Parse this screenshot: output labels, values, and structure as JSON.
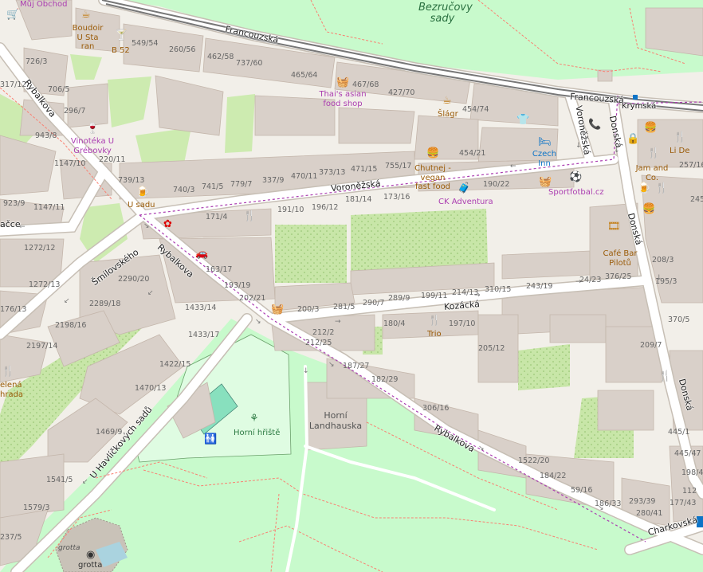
{
  "streets": {
    "francouzska_1": "Francouzská",
    "francouzska_2": "Francouzská",
    "krymska": "Krymská",
    "voronezska_1": "Voroněžská",
    "voronezska_2": "Voroněžská",
    "donska_1": "Donská",
    "donska_2": "Donská",
    "donska_3": "Donská",
    "rybalkova_1": "Rybalkova",
    "rybalkova_2": "Rybalkova",
    "rybalkova_3": "Rybalkova",
    "kozacka": "Kozácká",
    "smilovskeho": "Šmilovského",
    "u_havlickovych_sadu": "U Havlíčkových sadů",
    "charkovska": "Charkovská",
    "krymska_edge": "ačce"
  },
  "areas": {
    "bezrucovy_sady": "Bezručovy sady",
    "horni_landhauska": "Horní Landhauska",
    "horni_hriste": "Horní hřiště",
    "grotta_1": "grotta",
    "grotta_2": "grotta"
  },
  "pois": {
    "muj_obchod": "Můj Obchod",
    "boudoir": "Boudoir U Sta ran",
    "b52": "B 52",
    "thais_asian": "Thai's asian food shop",
    "slagr": "Šlágr",
    "vinoteka": "Vinotéka U Grébovky",
    "czech_inn": "Czech Inn",
    "chutnej": "Chutnej - vegan fast food",
    "ck_adventura": "CK Adventura",
    "sportfotbal": "Sportfotbal.cz",
    "u_sadu": "U sadu",
    "jam_and_co": "Jam and Co.",
    "li_de": "Li De",
    "cafe_bar_pilotu": "Café Bar Pilotů",
    "trio": "Trio",
    "zelena_zahrada": "elená hrada"
  },
  "housenumbers": [
    "549/54",
    "260/56",
    "462/58",
    "737/60",
    "465/64",
    "467/68",
    "427/70",
    "454/74",
    "726/3",
    "706/5",
    "296/7",
    "943/8",
    "1147/10",
    "220/11",
    "739/13",
    "740/3",
    "741/5",
    "779/7",
    "337/9",
    "470/11",
    "373/13",
    "471/15",
    "755/17",
    "454/21",
    "923/9",
    "1147/11",
    "171/4",
    "191/10",
    "196/12",
    "181/14",
    "173/16",
    "190/22",
    "1272/12",
    "1272/13",
    "163/17",
    "193/19",
    "202/21",
    "200/3",
    "281/5",
    "290/7",
    "289/9",
    "199/11",
    "214/13",
    "310/15",
    "243/19",
    "24/23",
    "376/25",
    "2290/20",
    "2289/18",
    "1433/14",
    "1433/17",
    "2198/16",
    "2197/14",
    "1422/15",
    "1470/13",
    "1469/9",
    "1541/5",
    "1579/3",
    "212/2",
    "212/25",
    "180/4",
    "197/10",
    "205/12",
    "187/27",
    "182/29",
    "306/16",
    "1522/20",
    "184/22",
    "59/16",
    "186/33",
    "293/39",
    "280/41",
    "177/43",
    "198/45",
    "445/47",
    "445/1",
    "208/3",
    "195/3",
    "370/5",
    "209/7",
    "257/16",
    "245/14",
    "317/12",
    "176/13",
    "237/5",
    "112",
    "27/4",
    "65/11",
    "22/1",
    "208/1"
  ],
  "colors": {
    "background": "#f2efe9",
    "building": "#d9d0c9",
    "park": "#c8facc",
    "grass": "#cdebb0",
    "road": "#ffffff",
    "road_casing": "#c7bfb5",
    "railway": "#707070",
    "boundary": "#ab3eb1",
    "footway": "#fa8072",
    "playground": "#dffce2",
    "pitch": "#88e0be"
  }
}
